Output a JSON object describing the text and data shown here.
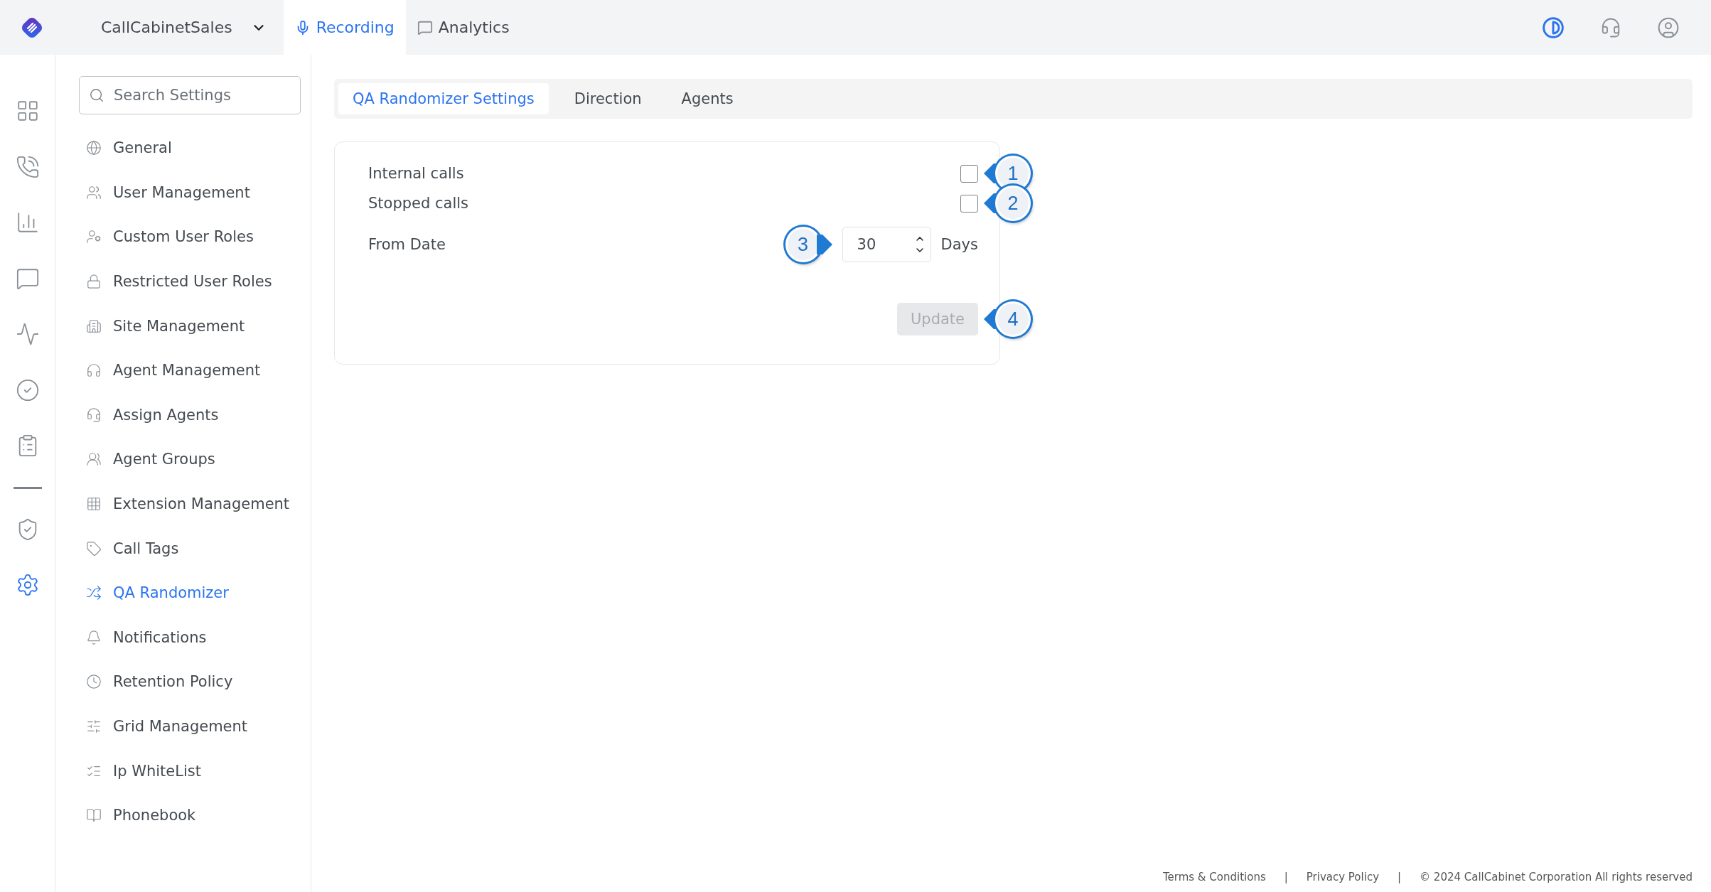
{
  "topbar": {
    "workspace": "CallCabinetSales",
    "nav_tabs": [
      {
        "label": "Recording",
        "selected": true
      },
      {
        "label": "Analytics",
        "selected": false
      }
    ]
  },
  "rail": {
    "items": [
      {
        "selected": false
      },
      {
        "selected": false
      },
      {
        "selected": false
      },
      {
        "selected": false
      },
      {
        "selected": false
      },
      {
        "selected": false
      },
      {
        "selected": false
      },
      {
        "selected": false
      },
      {
        "selected": true
      }
    ]
  },
  "settings_nav": {
    "search": {
      "placeholder": "Search Settings"
    },
    "items": [
      {
        "label": "General",
        "selected": false
      },
      {
        "label": "User Management",
        "selected": false
      },
      {
        "label": "Custom User Roles",
        "selected": false
      },
      {
        "label": "Restricted User Roles",
        "selected": false
      },
      {
        "label": "Site Management",
        "selected": false
      },
      {
        "label": "Agent Management",
        "selected": false
      },
      {
        "label": "Assign Agents",
        "selected": false
      },
      {
        "label": "Agent Groups",
        "selected": false
      },
      {
        "label": "Extension Management",
        "selected": false
      },
      {
        "label": "Call Tags",
        "selected": false
      },
      {
        "label": "QA Randomizer",
        "selected": true
      },
      {
        "label": "Notifications",
        "selected": false
      },
      {
        "label": "Retention Policy",
        "selected": false
      },
      {
        "label": "Grid Management",
        "selected": false
      },
      {
        "label": "Ip WhiteList",
        "selected": false
      },
      {
        "label": "Phonebook",
        "selected": false
      }
    ]
  },
  "tabs": [
    {
      "label": "QA Randomizer Settings",
      "selected": true
    },
    {
      "label": "Direction",
      "selected": false
    },
    {
      "label": "Agents",
      "selected": false
    }
  ],
  "form": {
    "checkboxes": [
      {
        "label": "Internal calls",
        "checked": false,
        "callout": "1"
      },
      {
        "label": "Stopped calls",
        "checked": false,
        "callout": "2"
      }
    ],
    "from_date": {
      "label": "From Date",
      "value": "30",
      "unit": "Days",
      "callout": "3"
    },
    "update": {
      "label": "Update",
      "disabled": true,
      "callout": "4"
    }
  },
  "footer": {
    "links": [
      "Terms & Conditions",
      "Privacy Policy"
    ],
    "separators": [
      "|",
      "|"
    ],
    "copyright": "© 2024 CallCabinet Corporation All rights reserved"
  }
}
